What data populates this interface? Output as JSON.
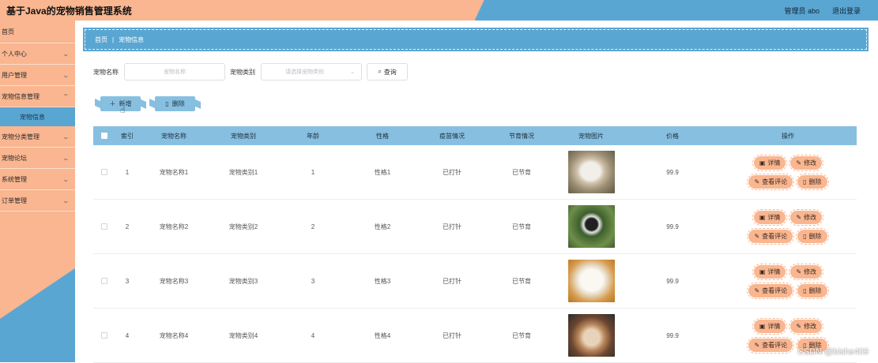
{
  "header": {
    "title": "基于Java的宠物销售管理系统",
    "user": "管理员 abo",
    "logout": "退出登录"
  },
  "sidebar": {
    "items": [
      {
        "label": "首页",
        "chev": false
      },
      {
        "label": "个人中心",
        "chev": true
      },
      {
        "label": "用户管理",
        "chev": true
      },
      {
        "label": "宠物信息管理",
        "chev": true
      }
    ],
    "active_sub": "宠物信息",
    "items_after": [
      {
        "label": "宠物分类管理",
        "chev": true
      },
      {
        "label": "宠物论坛",
        "chev": true
      },
      {
        "label": "系统管理",
        "chev": true
      },
      {
        "label": "订单管理",
        "chev": true
      }
    ]
  },
  "breadcrumb": {
    "home": "首页",
    "sep": "|",
    "current": "宠物信息"
  },
  "search": {
    "name_label": "宠物名称",
    "name_placeholder": "宠物名称",
    "type_label": "宠物类别",
    "type_placeholder": "请选择宠物类别",
    "query_label": "查询"
  },
  "actions": {
    "add_label": "新增",
    "delete_label": "删除"
  },
  "table": {
    "columns": [
      "索引",
      "宠物名称",
      "宠物类别",
      "年龄",
      "性格",
      "疫苗情况",
      "节育情况",
      "宠物图片",
      "价格",
      "操作"
    ],
    "rows": [
      {
        "index": "1",
        "name": "宠物名称1",
        "type": "宠物类别1",
        "age": "1",
        "personality": "性格1",
        "vaccine": "已打针",
        "sterilization": "已节育",
        "photo": "hamster-photo",
        "price": "99.9"
      },
      {
        "index": "2",
        "name": "宠物名称2",
        "type": "宠物类别2",
        "age": "2",
        "personality": "性格2",
        "vaccine": "已打针",
        "sterilization": "已节育",
        "photo": "border-collie-photo",
        "price": "99.9"
      },
      {
        "index": "3",
        "name": "宠物名称3",
        "type": "宠物类别3",
        "age": "3",
        "personality": "性格3",
        "vaccine": "已打针",
        "sterilization": "已节育",
        "photo": "white-poodle-photo",
        "price": "99.9"
      },
      {
        "index": "4",
        "name": "宠物名称4",
        "type": "宠物类别4",
        "age": "4",
        "personality": "性格4",
        "vaccine": "已打针",
        "sterilization": "已节育",
        "photo": "bulldog-photo",
        "price": "99.9"
      }
    ],
    "row_actions": {
      "detail": "详情",
      "edit": "修改",
      "comments": "查看评论",
      "delete": "删除"
    }
  },
  "watermark": "CSDN @bishe409",
  "colors": {
    "peach": "#f9b690",
    "blue": "#5aa6d2",
    "light_blue": "#87bfe0"
  }
}
